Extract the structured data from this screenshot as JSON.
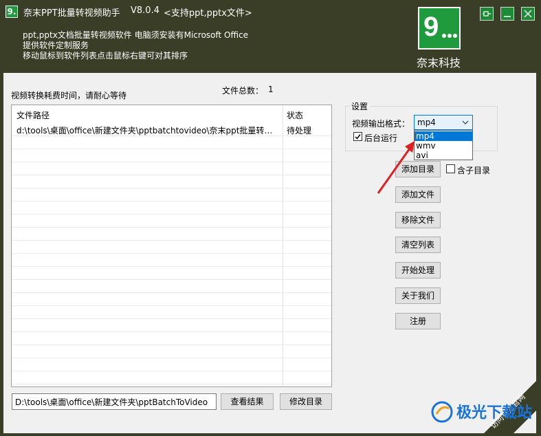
{
  "titlebar": {
    "logo_char": "9.",
    "title": "奈末PPT批量转视频助手",
    "version": "V8.0.4",
    "support": "<支持ppt,pptx文件>"
  },
  "description": [
    "ppt,pptx文档批量转视频软件  电脑须安装有Microsoft Office",
    "提供软件定制服务",
    "移动鼠标到软件列表点击鼠标右键可对其排序"
  ],
  "brand": {
    "logo_text": "9...",
    "name": "奈末科技"
  },
  "main": {
    "hint": "视频转换耗费时间，请耐心等待",
    "file_count_label": "文件总数：",
    "file_count": "1"
  },
  "file_list": {
    "columns": [
      "文件路径",
      "状态"
    ],
    "rows": [
      {
        "path": "d:\\tools\\桌面\\office\\新建文件夹\\pptbatchtovideo\\奈末ppt批量转视频助手...",
        "status": "待处理"
      }
    ]
  },
  "output": {
    "dir": "D:\\tools\\桌面\\office\\新建文件夹\\pptBatchToVideo",
    "view_result": "查看结果",
    "change_dir": "修改目录"
  },
  "settings": {
    "title": "设置",
    "format_label": "视频输出格式：",
    "format_selected": "mp4",
    "format_options": [
      "mp4",
      "wmv",
      "avi"
    ],
    "background_run_label": "后台运行",
    "background_run_checked": true
  },
  "actions": {
    "add_dir": "添加目录",
    "include_subdir": "含子目录",
    "include_subdir_checked": false,
    "add_file": "添加文件",
    "remove_file": "移除文件",
    "clear_list": "清空列表",
    "start": "开始处理",
    "about": "关于我们",
    "register": "注册"
  },
  "watermark": {
    "text": "极光下载站",
    "corner_text": "访问官方官网"
  },
  "colors": {
    "accent_green": "#1f9a3d",
    "select_blue": "#0078d7"
  }
}
